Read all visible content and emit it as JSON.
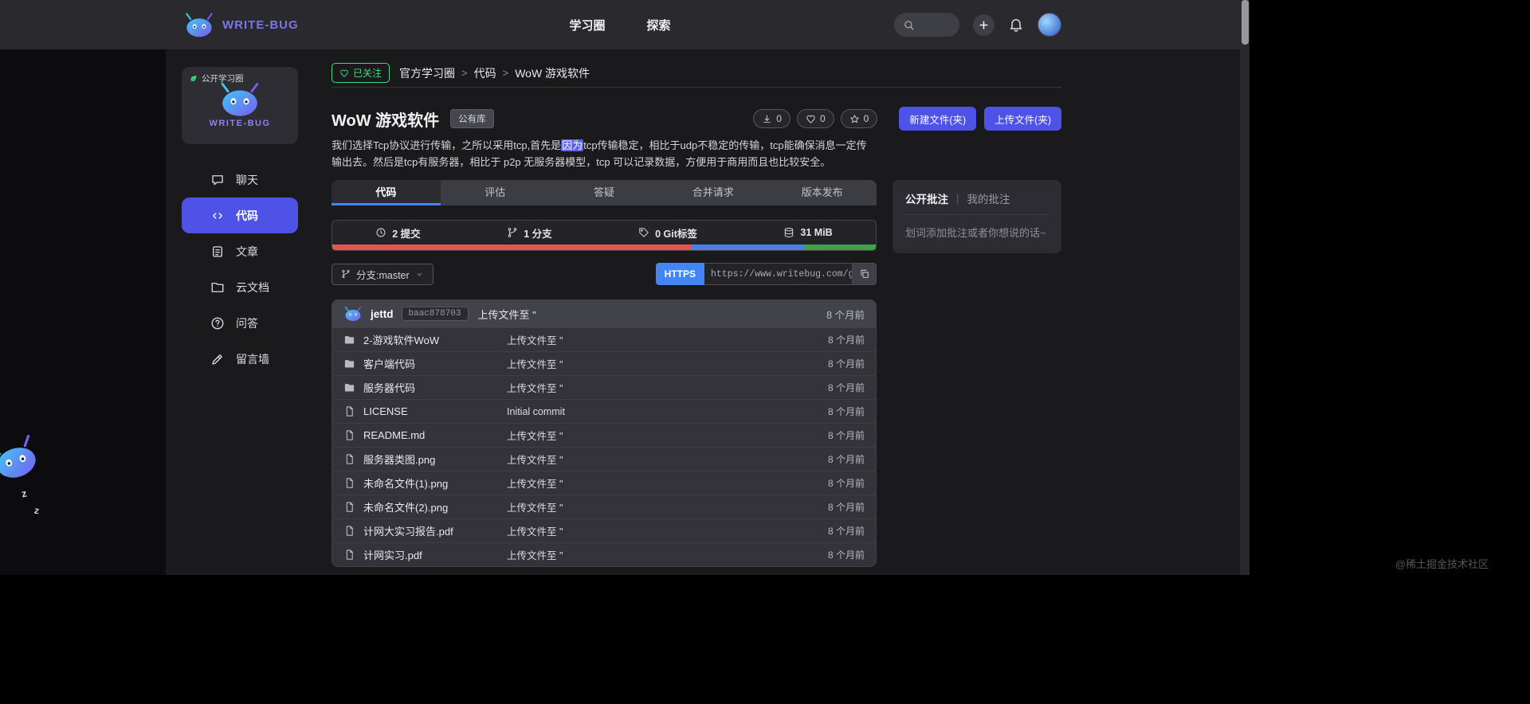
{
  "colors": {
    "accent": "#4f52e6",
    "https_blue": "#4285f4",
    "follow_green": "#3ddc84"
  },
  "topbar": {
    "brand": "WRITE-BUG",
    "nav": [
      "学习圈",
      "探索"
    ]
  },
  "sidebar": {
    "card_badge": "公开学习圈",
    "card_brand": "WRITE-BUG",
    "items": [
      {
        "icon": "chat",
        "label": "聊天",
        "active": false
      },
      {
        "icon": "code",
        "label": "代码",
        "active": true
      },
      {
        "icon": "article",
        "label": "文章",
        "active": false
      },
      {
        "icon": "folder",
        "label": "云文档",
        "active": false
      },
      {
        "icon": "question",
        "label": "问答",
        "active": false
      },
      {
        "icon": "wall",
        "label": "留言墙",
        "active": false
      }
    ]
  },
  "breadcrumb": {
    "followed_badge": "已关注",
    "items": [
      "官方学习圈",
      "代码",
      "WoW 游戏软件"
    ],
    "separator": ">"
  },
  "repo": {
    "title": "WoW 游戏软件",
    "visibility_badge": "公有库",
    "counters": [
      {
        "icon": "download",
        "value": "0"
      },
      {
        "icon": "heart",
        "value": "0"
      },
      {
        "icon": "star",
        "value": "0"
      }
    ],
    "new_button": "新建文件(夹)",
    "upload_button": "上传文件(夹)",
    "description": {
      "before": "我们选择Tcp协议进行传输，之所以采用tcp,首先是",
      "highlight": "因为",
      "after": "tcp传输稳定，相比于udp不稳定的传输，tcp能确保消息一定传输出去。然后是tcp有服务器，相比于 p2p 无服务器模型，tcp 可以记录数据，方便用于商用而且也比较安全。"
    }
  },
  "tabs": [
    {
      "label": "代码",
      "active": true
    },
    {
      "label": "评估",
      "active": false
    },
    {
      "label": "答疑",
      "active": false
    },
    {
      "label": "合并请求",
      "active": false
    },
    {
      "label": "版本发布",
      "active": false
    }
  ],
  "stats": [
    {
      "icon": "clock",
      "text": "2 提交"
    },
    {
      "icon": "branch",
      "text": "1 分支"
    },
    {
      "icon": "tag",
      "text": "0 Git标签"
    },
    {
      "icon": "database",
      "text": "31 MiB"
    }
  ],
  "language_bar": [
    {
      "name": "red",
      "color": "#e2574c",
      "percent": 66
    },
    {
      "name": "blue",
      "color": "#4a7fe8",
      "percent": 21
    },
    {
      "name": "green",
      "color": "#43a047",
      "percent": 13
    }
  ],
  "branch_selector": {
    "label": "分支:master"
  },
  "clone": {
    "protocol": "HTTPS",
    "url": "https://www.writebug.com/git/jettd/"
  },
  "latest_commit": {
    "author": "jettd",
    "hash": "baac878703",
    "message": "上传文件至 \"",
    "time": "8 个月前"
  },
  "files": [
    {
      "icon": "folder-filled",
      "name": "2-游戏软件WoW",
      "message": "上传文件至 \"",
      "time": "8 个月前"
    },
    {
      "icon": "folder-filled",
      "name": "客户端代码",
      "message": "上传文件至 \"",
      "time": "8 个月前"
    },
    {
      "icon": "folder-filled",
      "name": "服务器代码",
      "message": "上传文件至 \"",
      "time": "8 个月前"
    },
    {
      "icon": "file",
      "name": "LICENSE",
      "message": "Initial commit",
      "time": "8 个月前"
    },
    {
      "icon": "file",
      "name": "README.md",
      "message": "上传文件至 \"",
      "time": "8 个月前"
    },
    {
      "icon": "file",
      "name": "服务器类图.png",
      "message": "上传文件至 \"",
      "time": "8 个月前"
    },
    {
      "icon": "file",
      "name": "未命名文件(1).png",
      "message": "上传文件至 \"",
      "time": "8 个月前"
    },
    {
      "icon": "file",
      "name": "未命名文件(2).png",
      "message": "上传文件至 \"",
      "time": "8 个月前"
    },
    {
      "icon": "file",
      "name": "计网大实习报告.pdf",
      "message": "上传文件至 \"",
      "time": "8 个月前"
    },
    {
      "icon": "file",
      "name": "计网实习.pdf",
      "message": "上传文件至 \"",
      "time": "8 个月前"
    }
  ],
  "annotations": {
    "tab_public": "公开批注",
    "divider": "|",
    "tab_mine": "我的批注",
    "placeholder": "划词添加批注或者你想说的话~"
  },
  "mascot": {
    "zzz": [
      "z",
      "z"
    ]
  },
  "watermark": "@稀土掘金技术社区"
}
